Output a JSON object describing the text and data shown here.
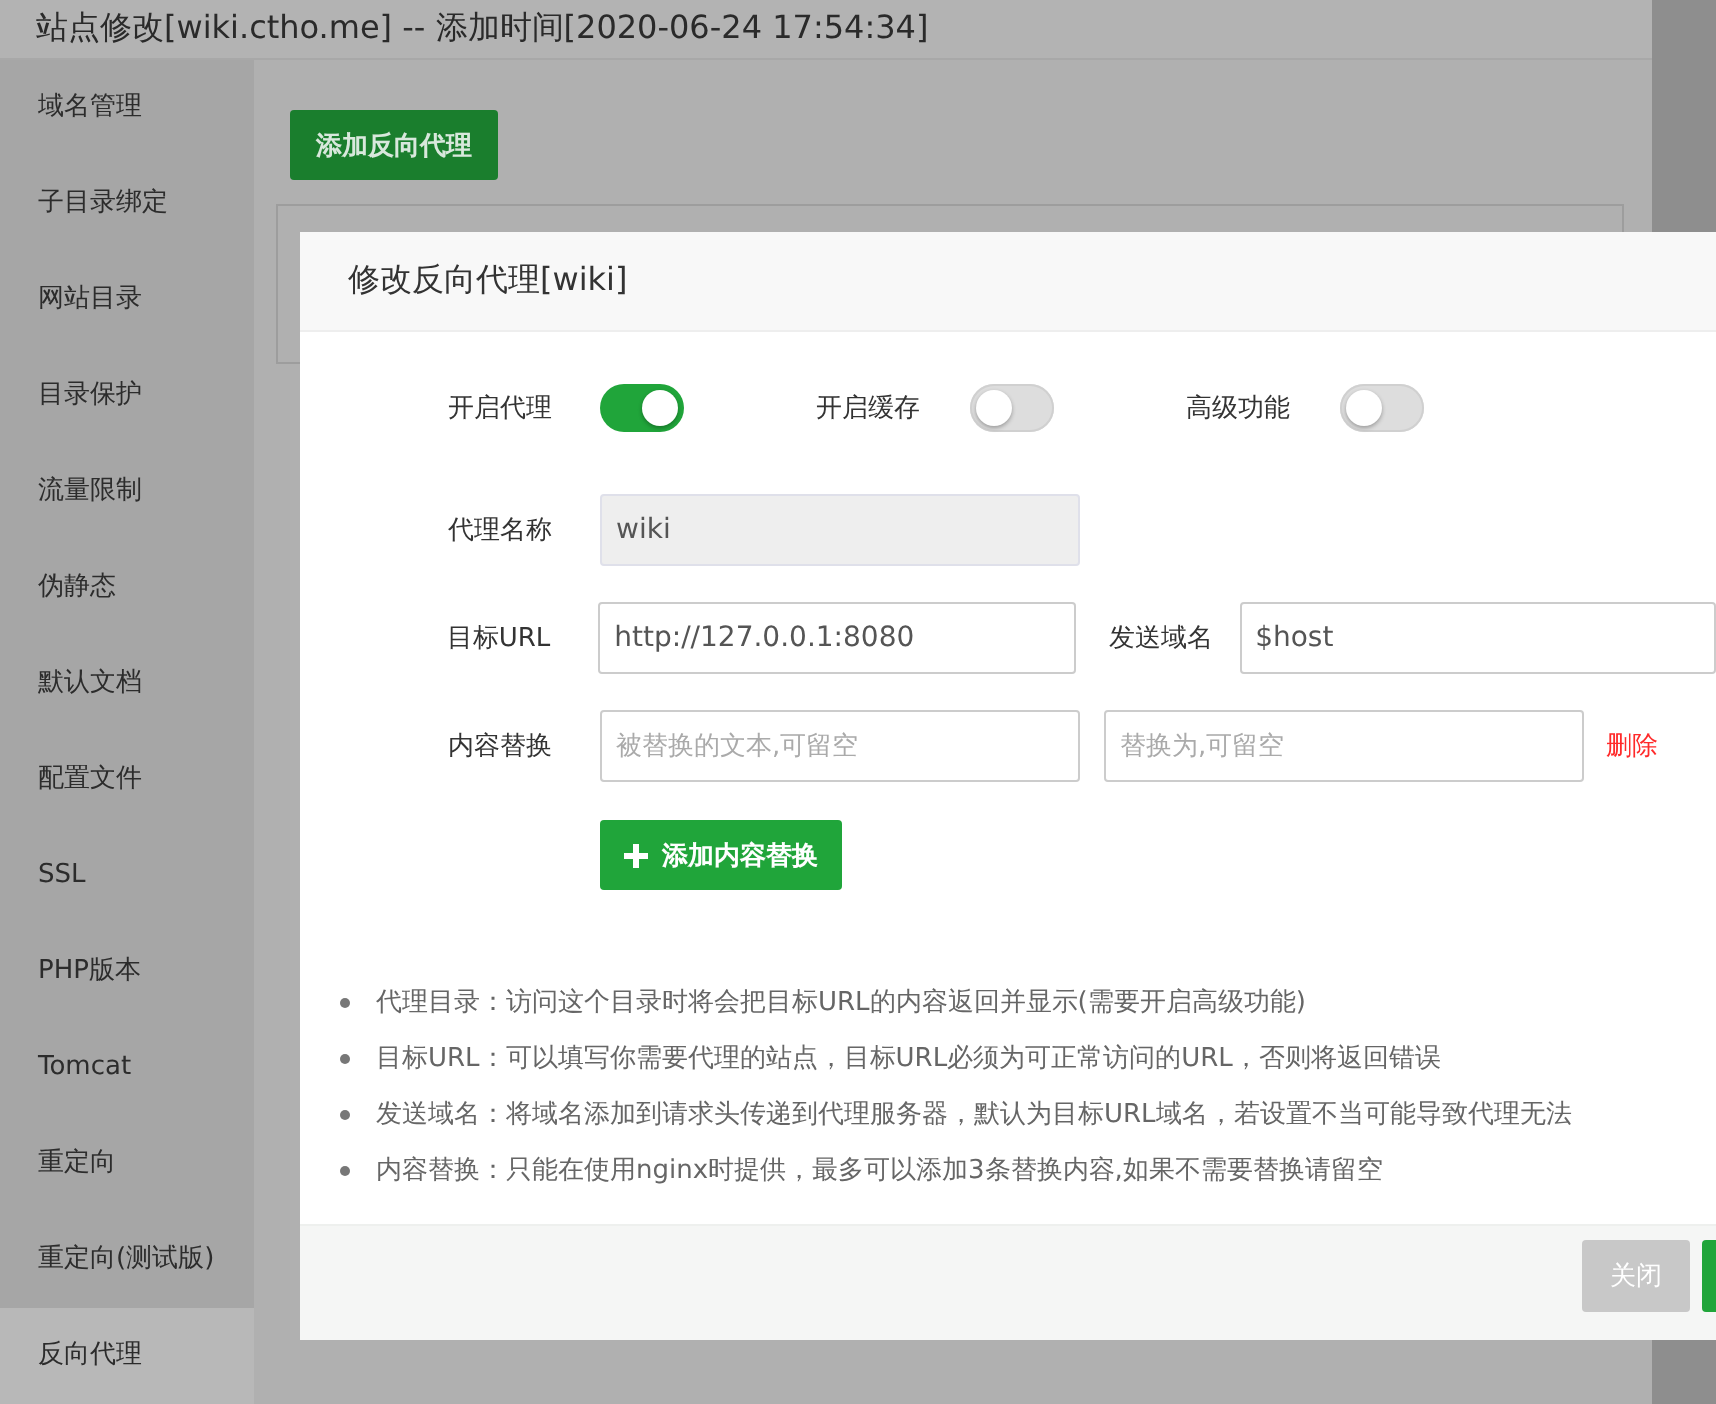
{
  "window": {
    "title": "站点修改[wiki.ctho.me] -- 添加时间[2020-06-24 17:54:34]"
  },
  "sidebar": {
    "items": [
      {
        "label": "域名管理",
        "selected": false
      },
      {
        "label": "子目录绑定",
        "selected": false
      },
      {
        "label": "网站目录",
        "selected": false
      },
      {
        "label": "目录保护",
        "selected": false
      },
      {
        "label": "流量限制",
        "selected": false
      },
      {
        "label": "伪静态",
        "selected": false
      },
      {
        "label": "默认文档",
        "selected": false
      },
      {
        "label": "配置文件",
        "selected": false
      },
      {
        "label": "SSL",
        "selected": false
      },
      {
        "label": "PHP版本",
        "selected": false
      },
      {
        "label": "Tomcat",
        "selected": false
      },
      {
        "label": "重定向",
        "selected": false
      },
      {
        "label": "重定向(测试版)",
        "selected": false
      },
      {
        "label": "反向代理",
        "selected": true
      }
    ]
  },
  "content": {
    "add_button": "添加反向代理"
  },
  "dialog": {
    "title": "修改反向代理[wiki]",
    "toggles": [
      {
        "label": "开启代理",
        "on": true
      },
      {
        "label": "开启缓存",
        "on": false
      },
      {
        "label": "高级功能",
        "on": false
      }
    ],
    "proxy_name": {
      "label": "代理名称",
      "value": "wiki",
      "disabled": true
    },
    "target_url": {
      "label": "目标URL",
      "value": "http://127.0.0.1:8080"
    },
    "send_domain": {
      "label": "发送域名",
      "value": "$host"
    },
    "replace": {
      "label": "内容替换",
      "from_placeholder": "被替换的文本,可留空",
      "to_placeholder": "替换为,可留空",
      "delete": "删除"
    },
    "add_replace_button": "添加内容替换",
    "notes": [
      "代理目录：访问这个目录时将会把目标URL的内容返回并显示(需要开启高级功能)",
      "目标URL：可以填写你需要代理的站点，目标URL必须为可正常访问的URL，否则将返回错误",
      "发送域名：将域名添加到请求头传递到代理服务器，默认为目标URL域名，若设置不当可能导致代理无法",
      "内容替换：只能在使用nginx时提供，最多可以添加3条替换内容,如果不需要替换请留空"
    ],
    "footer": {
      "close_button": "关闭"
    }
  }
}
